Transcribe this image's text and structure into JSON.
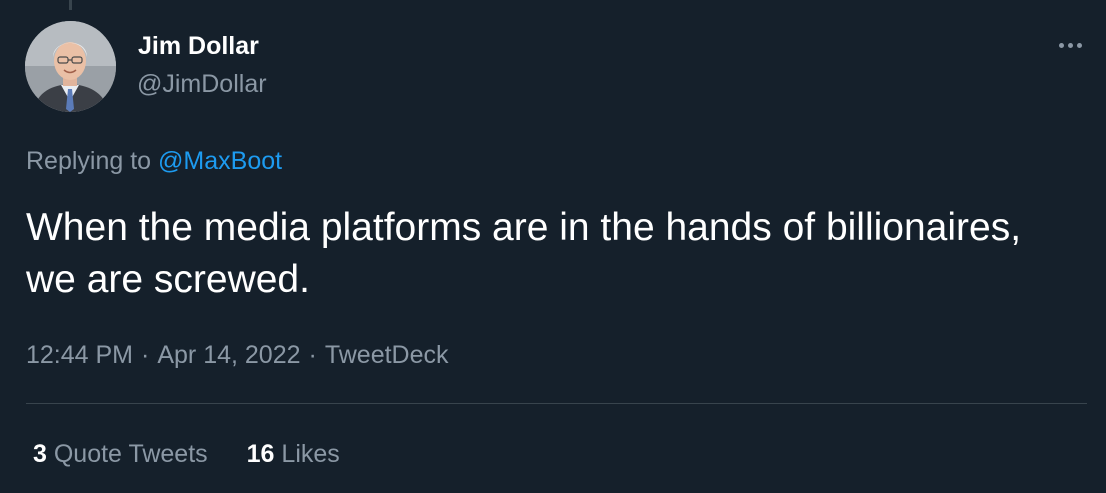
{
  "colors": {
    "background": "#15202b",
    "primary_text": "#ffffff",
    "secondary_text": "#8b98a5",
    "accent": "#1d9bf0",
    "divider": "#38444d"
  },
  "author": {
    "display_name": "Jim Dollar",
    "handle": "@JimDollar",
    "avatar_icon": "profile-photo-avatar"
  },
  "more_icon": "more-horizontal-icon",
  "reply_context": {
    "prefix": "Replying to",
    "mention": "@MaxBoot"
  },
  "tweet": {
    "text": "When the media platforms are in the hands of billionaires, we are screwed."
  },
  "meta": {
    "time": "12:44 PM",
    "date": "Apr 14, 2022",
    "source": "TweetDeck",
    "separator": "·"
  },
  "stats": {
    "quote_tweets_count": "3",
    "quote_tweets_label": "Quote Tweets",
    "likes_count": "16",
    "likes_label": "Likes"
  }
}
